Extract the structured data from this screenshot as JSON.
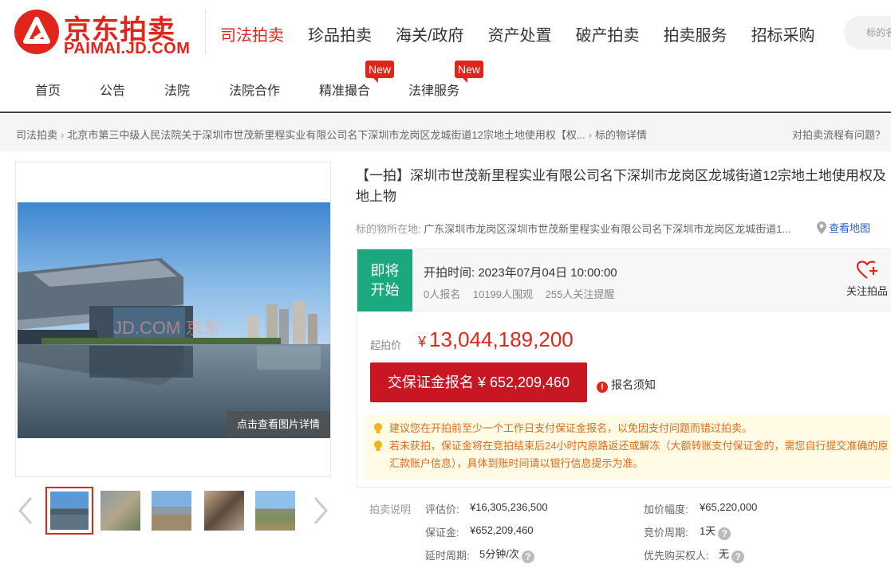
{
  "brand": {
    "name_cn": "京东拍卖",
    "name_en": "PAIMAI.JD.COM",
    "accent": "#e1251b"
  },
  "main_nav": [
    "司法拍卖",
    "珍品拍卖",
    "海关/政府",
    "资产处置",
    "破产拍卖",
    "拍卖服务",
    "招标采购"
  ],
  "search": {
    "placeholder": "标的名"
  },
  "sub_nav": [
    "首页",
    "公告",
    "法院",
    "法院合作",
    "精准撮合",
    "法律服务"
  ],
  "badge_new": "New",
  "breadcrumb": [
    "司法拍卖",
    "北京市第三中级人民法院关于深圳市世茂新里程实业有限公司名下深圳市龙岗区龙城街道12宗地土地使用权【权...",
    "标的物详情"
  ],
  "help_text": "对拍卖流程有问题？",
  "gallery": {
    "watermark": "JD.COM 京东",
    "detail_button": "点击查看图片详情",
    "thumbnails": [
      "thumb-1",
      "thumb-2",
      "thumb-3",
      "thumb-4",
      "thumb-5"
    ],
    "selected_index": 0
  },
  "item": {
    "title": "【一拍】深圳市世茂新里程实业有限公司名下深圳市龙岗区龙城街道12宗地土地使用权及地上物",
    "location_label": "标的物所在地:",
    "location_value": "广东深圳市龙岗区深圳市世茂新里程实业有限公司名下深圳市龙岗区龙城街道1...",
    "map_link": "查看地图"
  },
  "auction": {
    "status_line1": "即将",
    "status_line2": "开始",
    "start_time": "开拍时间:  2023年07月04日 10:00:00",
    "registered": "0人报名",
    "watchers": "10199人围观",
    "reminders": "255人关注提醒",
    "follow_label": "关注拍品",
    "start_price_label": "起拍价",
    "currency": "¥",
    "start_price": "13,044,189,200",
    "deposit_button": "交保证金报名 ¥ 652,209,460",
    "notice_label": "报名须知",
    "tips": [
      "建议您在开拍前至少一个工作日支付保证金报名，以免因支付问题而错过拍卖。",
      "若未获拍，保证金将在竞拍结束后24小时内原路返还或解冻（大额转账支付保证金的，需您自行提交准确的原汇款账户信息），具体到账时间请以银行信息提示为准。"
    ]
  },
  "details": {
    "section_label": "拍卖说明",
    "appraisal_label": "评估价:",
    "appraisal_value": "¥16,305,236,500",
    "increment_label": "加价幅度:",
    "increment_value": "¥65,220,000",
    "deposit_label": "保证金:",
    "deposit_value": "¥652,209,460",
    "cycle_label": "竞价周期:",
    "cycle_value": "1天",
    "extension_label": "延时周期:",
    "extension_value": "5分钟/次",
    "priority_label": "优先购买权人:",
    "priority_value": "无"
  }
}
